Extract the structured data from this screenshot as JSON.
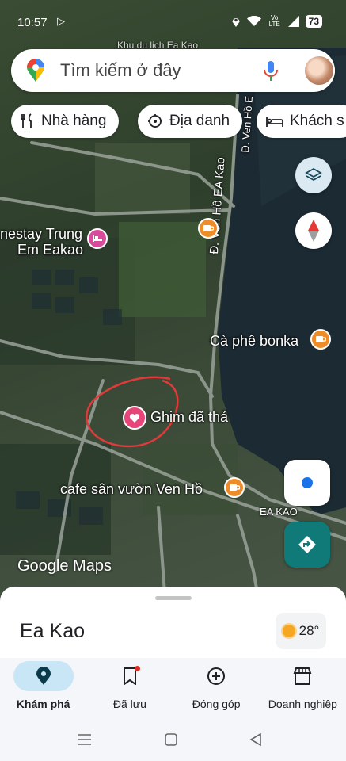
{
  "status_bar": {
    "time": "10:57",
    "network": "Vo LTE",
    "battery": "73"
  },
  "search": {
    "placeholder": "Tìm kiếm ở đây"
  },
  "chips": [
    {
      "label": "Nhà hàng",
      "icon": "fork-knife-icon"
    },
    {
      "label": "Địa danh",
      "icon": "landmark-icon"
    },
    {
      "label": "Khách s",
      "icon": "bed-icon"
    }
  ],
  "map": {
    "roads": [
      "Đ. Ven Hồ EA Kao",
      "Đ. Ven Hồ E"
    ],
    "places": [
      {
        "name": "nestay Trung\nEm Eakao",
        "line1": "nestay Trung",
        "line2": "Em Eakao",
        "type": "hotel"
      },
      {
        "name": "Cà phê bonka",
        "type": "cafe"
      },
      {
        "name": "Ghim đã thả",
        "type": "dropped-pin"
      },
      {
        "name": "cafe sân vườn Ven Hồ",
        "type": "cafe"
      },
      {
        "name": "EA KAO",
        "type": "area"
      }
    ],
    "top_partial_label": "Khu du lịch Ea Kao",
    "logo": "Google Maps"
  },
  "sheet": {
    "title": "Ea Kao",
    "temperature": "28°"
  },
  "bottom_nav": [
    {
      "label": "Khám phá",
      "icon": "explore-pin-icon",
      "active": true
    },
    {
      "label": "Đã lưu",
      "icon": "bookmark-icon",
      "active": false
    },
    {
      "label": "Đóng góp",
      "icon": "add-circle-icon",
      "active": false
    },
    {
      "label": "Doanh nghiệp",
      "icon": "storefront-icon",
      "active": false
    }
  ],
  "colors": {
    "accent": "#0f7a78",
    "nav_active": "#c8e6f5",
    "pin": "#e8457a",
    "cafe": "#ef8c2a"
  }
}
